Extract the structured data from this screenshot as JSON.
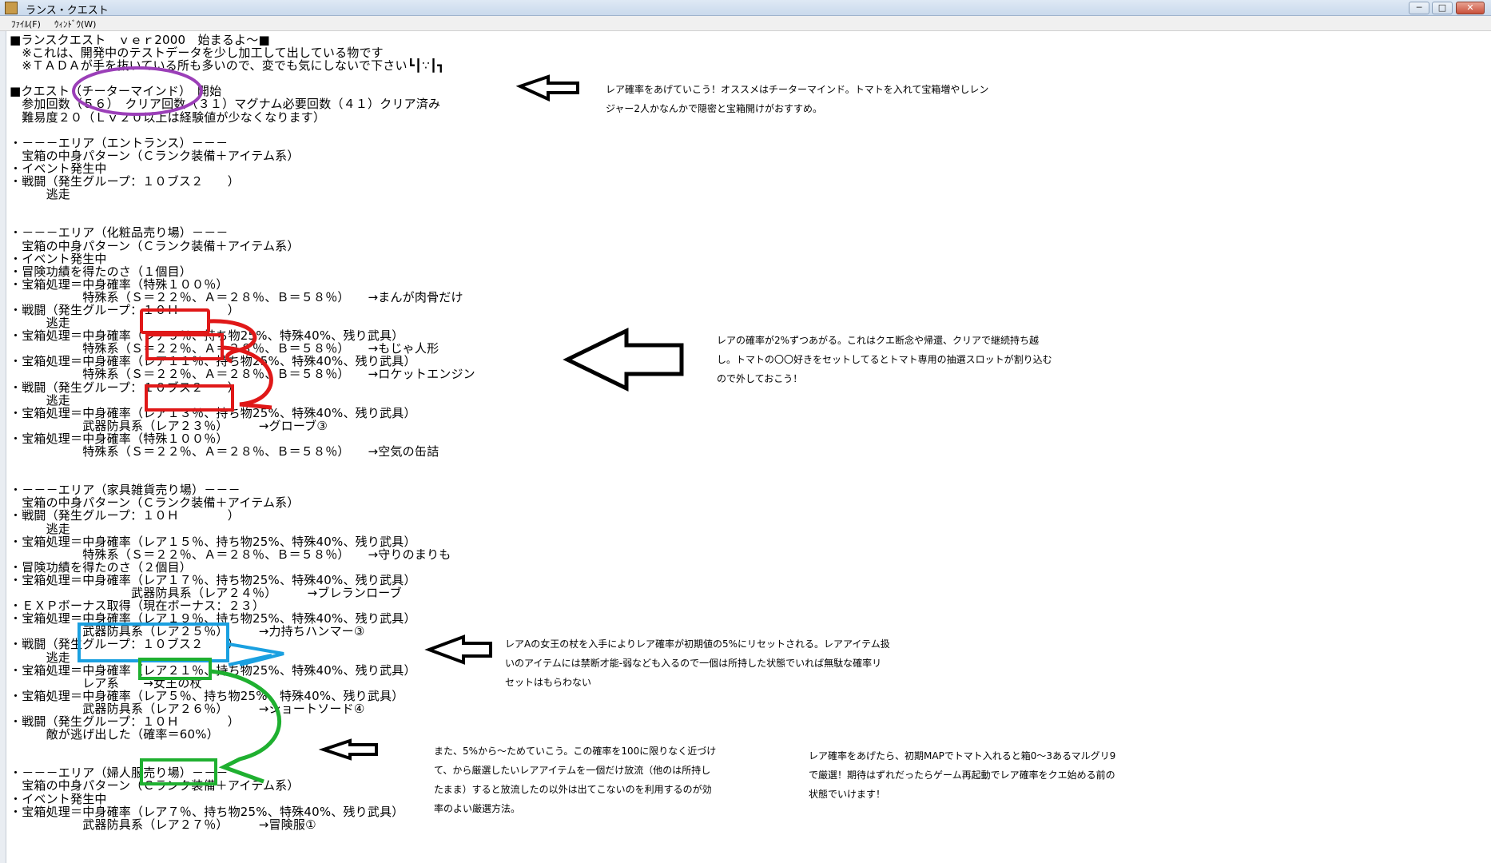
{
  "window": {
    "title": "ランス・クエスト",
    "menu": [
      "ﾌｧｲﾙ(F)",
      "ｳｨﾝﾄﾞｳ(W)"
    ],
    "buttons": {
      "minimize": "─",
      "maximize": "□",
      "close": "✕"
    }
  },
  "log_lines": [
    "■ランスクエスト　ｖｅｒ2000　始まるよ～■",
    "　※これは、開発中のテストデータを少し加工して出している物です",
    "　※ＴＡＤＡが手を抜いている所も多いので、変でも気にしないで下さい┗┃∵┃┓",
    "",
    "■クエスト（チーターマインド）　開始",
    "　参加回数（５６）　クリア回数（３１）マグナム必要回数（４１）クリア済み",
    "　難易度２０（Ｌｖ２０以上は経験値が少なくなります）",
    "",
    "・－－－エリア（エントランス）－－－",
    "　宝箱の中身パターン（Ｃランク装備＋アイテム系）",
    "・イベント発生中",
    "・戦闘（発生グループ：１０ブス２　　）",
    "　　　逃走",
    "",
    "",
    "・－－－エリア（化粧品売り場）－－－",
    "　宝箱の中身パターン（Ｃランク装備＋アイテム系）",
    "・イベント発生中",
    "・冒険功績を得たのさ（１個目）",
    "・宝箱処理＝中身確率（特殊１００％）",
    "　　　　　　特殊系（Ｓ＝２２％、Ａ＝２８％、Ｂ＝５８％）　　→まんが肉骨だけ",
    "・戦闘（発生グループ：１０Ｈ　　　　）",
    "　　　逃走",
    "・宝箱処理＝中身確率（レア９％、持ち物25%、特殊40%、残り武具）",
    "　　　　　　特殊系（Ｓ＝２２％、Ａ＝２８％、Ｂ＝５８％）　　→もじゃ人形",
    "・宝箱処理＝中身確率（レア１１％、持ち物25%、特殊40%、残り武具）",
    "　　　　　　特殊系（Ｓ＝２２％、Ａ＝２８％、Ｂ＝５８％）　　→ロケットエンジン",
    "・戦闘（発生グループ：１０ブス２　　）",
    "　　　逃走",
    "・宝箱処理＝中身確率（レア１３％、持ち物25%、特殊40%、残り武具）",
    "　　　　　　武器防具系（レア２３％）　　　→グローブ③",
    "・宝箱処理＝中身確率（特殊１００％）",
    "　　　　　　特殊系（Ｓ＝２２％、Ａ＝２８％、Ｂ＝５８％）　　→空気の缶詰",
    "",
    "",
    "・－－－エリア（家具雑貨売り場）－－－",
    "　宝箱の中身パターン（Ｃランク装備＋アイテム系）",
    "・戦闘（発生グループ：１０Ｈ　　　　）",
    "　　　逃走",
    "・宝箱処理＝中身確率（レア１５％、持ち物25%、特殊40%、残り武具）",
    "　　　　　　特殊系（Ｓ＝２２％、Ａ＝２８％、Ｂ＝５８％）　　→守りのまりも",
    "・冒険功績を得たのさ（２個目）",
    "・宝箱処理＝中身確率（レア１７％、持ち物25%、特殊40%、残り武具）",
    "　　　　　　　　　　武器防具系（レア２４％）　　　→ブレランローブ",
    "・ＥＸＰボーナス取得（現在ボーナス：２３）",
    "・宝箱処理＝中身確率（レア１９％、持ち物25%、特殊40%、残り武具）",
    "　　　　　　武器防具系（レア２５％）　　　→力持ちハンマー③",
    "・戦闘（発生グループ：１０ブス２　　）",
    "　　　逃走",
    "・宝箱処理＝中身確率（レア２１％、持ち物25%、特殊40%、残り武具）",
    "　　　　　　レア系　　→女王の杖",
    "・宝箱処理＝中身確率（レア５％、持ち物25%、特殊40%、残り武具）",
    "　　　　　　武器防具系（レア２６％）　　　→ショートソード④",
    "・戦闘（発生グループ：１０Ｈ　　　　）",
    "　　　敵が逃げ出した（確率＝60%）",
    "",
    "",
    "・－－－エリア（婦人服売り場）－－－",
    "　宝箱の中身パターン（Ｃランク装備＋アイテム系）",
    "・イベント発生中",
    "・宝箱処理＝中身確率（レア７％、持ち物25%、特殊40%、残り武具）",
    "　　　　　　武器防具系（レア２７％）　　　→冒険服①"
  ],
  "notes": {
    "note1": [
      "レア確率をあげていこう！オススメはチーターマインド。トマトを入れて宝箱増やしレン",
      "ジャー2人かなんかで隠密と宝箱開けがおすすめ。"
    ],
    "note2": [
      "レアの確率が2%ずつあがる。これはクエ断念や帰還、クリアで継続持ち越",
      "し。トマトの〇〇好きをセットしてるとトマト専用の抽選スロットが割り込む",
      "ので外しておこう！"
    ],
    "note3": [
      "レアAの女王の杖を入手によりレア確率が初期値の5%にリセットされる。レアアイテム扱",
      "いのアイテムには禁断才能-弱なども入るので一個は所持した状態でいれば無駄な確率リ",
      "セットはもらわない"
    ],
    "note4": [
      "また、5%から～ためていこう。この確率を100に限りなく近づけ",
      "て、から厳選したいレアアイテムを一個だけ放流（他のは所持し",
      "たまま）すると放流したの以外は出てこないのを利用するのが効",
      "率のよい厳選方法。"
    ],
    "note5": [
      "レア確率をあげたら、初期MAPでトマト入れると箱0～3あるマルグリ9",
      "で厳選！期待はずれだったらゲーム再起動でレア確率をクエ始める前の",
      "状態でいけます！"
    ]
  },
  "annotation_colors": {
    "purple": "#9b3fb8",
    "red": "#e01818",
    "blue": "#1aa0e0",
    "green": "#1fb030",
    "arrow": "#000000"
  }
}
